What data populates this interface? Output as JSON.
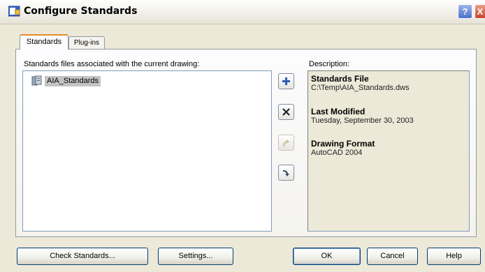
{
  "window": {
    "title": "Configure Standards",
    "help_glyph": "?",
    "close_glyph": "X"
  },
  "tabs": [
    {
      "label": "Standards",
      "active": true
    },
    {
      "label": "Plug-ins",
      "active": false
    }
  ],
  "files_panel": {
    "label": "Standards files associated with the current drawing:",
    "items": [
      {
        "label": "AIA_Standards",
        "icon": "standards-file-icon",
        "selected": true
      }
    ]
  },
  "side_buttons": [
    {
      "name": "add",
      "icon": "plus-icon",
      "enabled": true
    },
    {
      "name": "remove",
      "icon": "x-icon",
      "enabled": true
    },
    {
      "name": "move-up",
      "icon": "arrow-up-icon",
      "enabled": false
    },
    {
      "name": "move-down",
      "icon": "arrow-down-icon",
      "enabled": true
    }
  ],
  "description": {
    "label": "Description:",
    "sections": [
      {
        "heading": "Standards File",
        "value": "C:\\Temp\\AIA_Standards.dws"
      },
      {
        "heading": "Last Modified",
        "value": "Tuesday, September 30, 2003"
      },
      {
        "heading": "Drawing Format",
        "value": "AutoCAD 2004"
      }
    ]
  },
  "buttons": {
    "check_standards": "Check Standards...",
    "settings": "Settings...",
    "ok": "OK",
    "cancel": "Cancel",
    "help": "Help"
  },
  "colors": {
    "accent_tab": "#e68b2c",
    "selection": "#c4c4c4",
    "plus_blue": "#2b5fb4"
  }
}
